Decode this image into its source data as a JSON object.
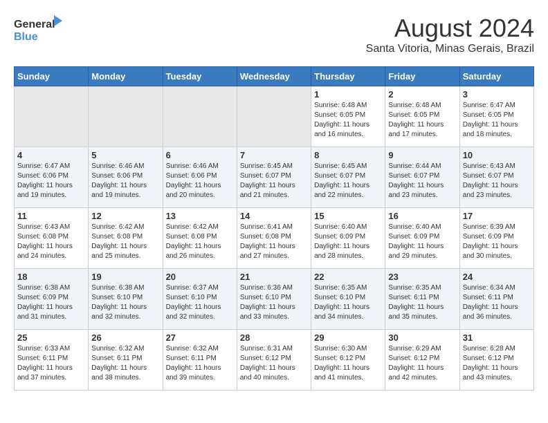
{
  "logo": {
    "line1": "General",
    "line2": "Blue"
  },
  "title": "August 2024",
  "subtitle": "Santa Vitoria, Minas Gerais, Brazil",
  "days_of_week": [
    "Sunday",
    "Monday",
    "Tuesday",
    "Wednesday",
    "Thursday",
    "Friday",
    "Saturday"
  ],
  "weeks": [
    [
      {
        "day": "",
        "empty": true
      },
      {
        "day": "",
        "empty": true
      },
      {
        "day": "",
        "empty": true
      },
      {
        "day": "",
        "empty": true
      },
      {
        "day": "1",
        "sunrise": "6:48 AM",
        "sunset": "6:05 PM",
        "daylight": "11 hours and 16 minutes."
      },
      {
        "day": "2",
        "sunrise": "6:48 AM",
        "sunset": "6:05 PM",
        "daylight": "11 hours and 17 minutes."
      },
      {
        "day": "3",
        "sunrise": "6:47 AM",
        "sunset": "6:05 PM",
        "daylight": "11 hours and 18 minutes."
      }
    ],
    [
      {
        "day": "4",
        "sunrise": "6:47 AM",
        "sunset": "6:06 PM",
        "daylight": "11 hours and 19 minutes."
      },
      {
        "day": "5",
        "sunrise": "6:46 AM",
        "sunset": "6:06 PM",
        "daylight": "11 hours and 19 minutes."
      },
      {
        "day": "6",
        "sunrise": "6:46 AM",
        "sunset": "6:06 PM",
        "daylight": "11 hours and 20 minutes."
      },
      {
        "day": "7",
        "sunrise": "6:45 AM",
        "sunset": "6:07 PM",
        "daylight": "11 hours and 21 minutes."
      },
      {
        "day": "8",
        "sunrise": "6:45 AM",
        "sunset": "6:07 PM",
        "daylight": "11 hours and 22 minutes."
      },
      {
        "day": "9",
        "sunrise": "6:44 AM",
        "sunset": "6:07 PM",
        "daylight": "11 hours and 23 minutes."
      },
      {
        "day": "10",
        "sunrise": "6:43 AM",
        "sunset": "6:07 PM",
        "daylight": "11 hours and 23 minutes."
      }
    ],
    [
      {
        "day": "11",
        "sunrise": "6:43 AM",
        "sunset": "6:08 PM",
        "daylight": "11 hours and 24 minutes."
      },
      {
        "day": "12",
        "sunrise": "6:42 AM",
        "sunset": "6:08 PM",
        "daylight": "11 hours and 25 minutes."
      },
      {
        "day": "13",
        "sunrise": "6:42 AM",
        "sunset": "6:08 PM",
        "daylight": "11 hours and 26 minutes."
      },
      {
        "day": "14",
        "sunrise": "6:41 AM",
        "sunset": "6:08 PM",
        "daylight": "11 hours and 27 minutes."
      },
      {
        "day": "15",
        "sunrise": "6:40 AM",
        "sunset": "6:09 PM",
        "daylight": "11 hours and 28 minutes."
      },
      {
        "day": "16",
        "sunrise": "6:40 AM",
        "sunset": "6:09 PM",
        "daylight": "11 hours and 29 minutes."
      },
      {
        "day": "17",
        "sunrise": "6:39 AM",
        "sunset": "6:09 PM",
        "daylight": "11 hours and 30 minutes."
      }
    ],
    [
      {
        "day": "18",
        "sunrise": "6:38 AM",
        "sunset": "6:09 PM",
        "daylight": "11 hours and 31 minutes."
      },
      {
        "day": "19",
        "sunrise": "6:38 AM",
        "sunset": "6:10 PM",
        "daylight": "11 hours and 32 minutes."
      },
      {
        "day": "20",
        "sunrise": "6:37 AM",
        "sunset": "6:10 PM",
        "daylight": "11 hours and 32 minutes."
      },
      {
        "day": "21",
        "sunrise": "6:36 AM",
        "sunset": "6:10 PM",
        "daylight": "11 hours and 33 minutes."
      },
      {
        "day": "22",
        "sunrise": "6:35 AM",
        "sunset": "6:10 PM",
        "daylight": "11 hours and 34 minutes."
      },
      {
        "day": "23",
        "sunrise": "6:35 AM",
        "sunset": "6:11 PM",
        "daylight": "11 hours and 35 minutes."
      },
      {
        "day": "24",
        "sunrise": "6:34 AM",
        "sunset": "6:11 PM",
        "daylight": "11 hours and 36 minutes."
      }
    ],
    [
      {
        "day": "25",
        "sunrise": "6:33 AM",
        "sunset": "6:11 PM",
        "daylight": "11 hours and 37 minutes."
      },
      {
        "day": "26",
        "sunrise": "6:32 AM",
        "sunset": "6:11 PM",
        "daylight": "11 hours and 38 minutes."
      },
      {
        "day": "27",
        "sunrise": "6:32 AM",
        "sunset": "6:11 PM",
        "daylight": "11 hours and 39 minutes."
      },
      {
        "day": "28",
        "sunrise": "6:31 AM",
        "sunset": "6:12 PM",
        "daylight": "11 hours and 40 minutes."
      },
      {
        "day": "29",
        "sunrise": "6:30 AM",
        "sunset": "6:12 PM",
        "daylight": "11 hours and 41 minutes."
      },
      {
        "day": "30",
        "sunrise": "6:29 AM",
        "sunset": "6:12 PM",
        "daylight": "11 hours and 42 minutes."
      },
      {
        "day": "31",
        "sunrise": "6:28 AM",
        "sunset": "6:12 PM",
        "daylight": "11 hours and 43 minutes."
      }
    ]
  ]
}
